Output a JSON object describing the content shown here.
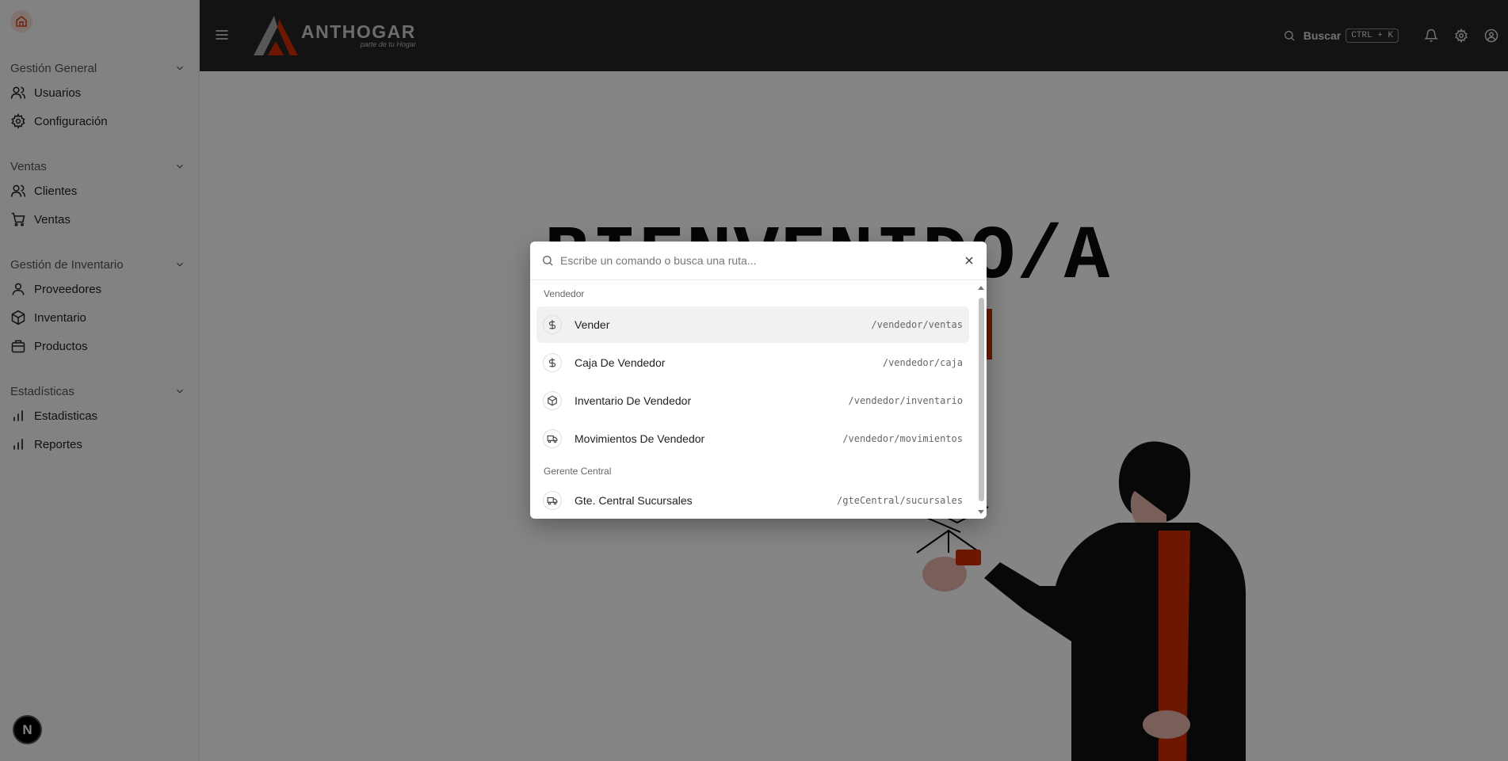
{
  "sidebar": {
    "groups": [
      {
        "title": "Gestión General",
        "items": [
          {
            "label": "Usuarios",
            "icon": "users-icon"
          },
          {
            "label": "Configuración",
            "icon": "gear-icon"
          }
        ]
      },
      {
        "title": "Ventas",
        "items": [
          {
            "label": "Clientes",
            "icon": "users-icon"
          },
          {
            "label": "Ventas",
            "icon": "cart-icon"
          }
        ]
      },
      {
        "title": "Gestión de Inventario",
        "items": [
          {
            "label": "Proveedores",
            "icon": "user-icon"
          },
          {
            "label": "Inventario",
            "icon": "box-icon"
          },
          {
            "label": "Productos",
            "icon": "package-icon"
          }
        ]
      },
      {
        "title": "Estadísticas",
        "items": [
          {
            "label": "Estadisticas",
            "icon": "bar-chart-icon"
          },
          {
            "label": "Reportes",
            "icon": "bar-chart-icon"
          }
        ]
      }
    ]
  },
  "topbar": {
    "logo_text": "ANTHOGAR",
    "logo_tagline": "parte de tu Hogar",
    "search_label": "Buscar",
    "shortcut": "CTRL + K"
  },
  "main": {
    "welcome": "BIENVENIDO/A"
  },
  "command_dialog": {
    "placeholder": "Escribe un comando o busca una ruta...",
    "sections": [
      {
        "title": "Vendedor",
        "items": [
          {
            "label": "Vender",
            "path": "/vendedor/ventas",
            "icon": "dollar-icon"
          },
          {
            "label": "Caja De Vendedor",
            "path": "/vendedor/caja",
            "icon": "dollar-icon"
          },
          {
            "label": "Inventario De Vendedor",
            "path": "/vendedor/inventario",
            "icon": "box-icon"
          },
          {
            "label": "Movimientos De Vendedor",
            "path": "/vendedor/movimientos",
            "icon": "truck-icon"
          }
        ]
      },
      {
        "title": "Gerente Central",
        "items": [
          {
            "label": "Gte. Central Sucursales",
            "path": "/gteCentral/sucursales",
            "icon": "truck-icon"
          }
        ]
      }
    ]
  },
  "colors": {
    "accent": "#d12d00",
    "topbar": "#262626",
    "sidebar": "#fafafa",
    "overlay": "rgba(0,0,0,0.48)"
  },
  "badge": "N"
}
